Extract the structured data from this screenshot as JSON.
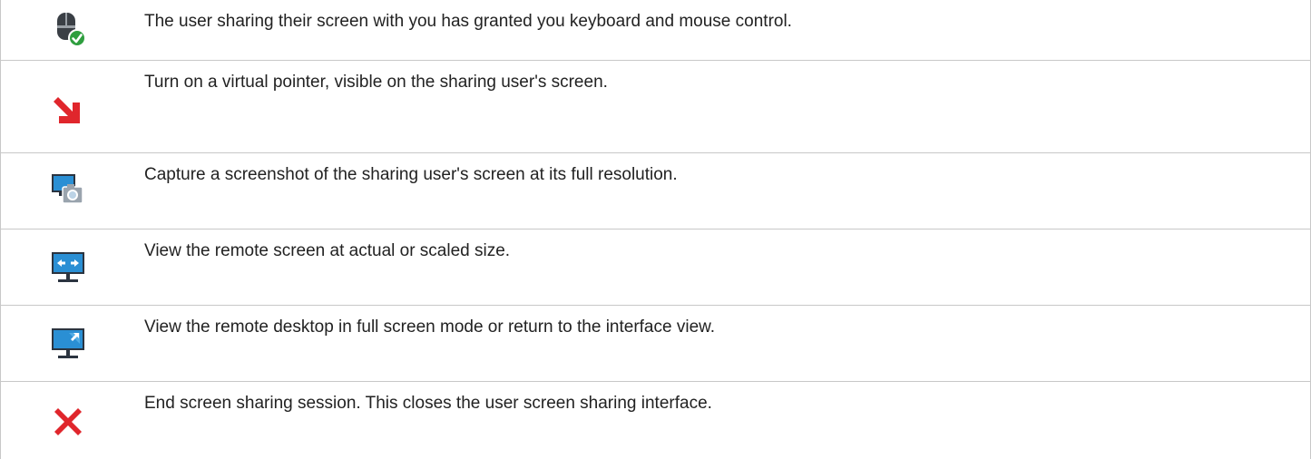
{
  "rows": [
    {
      "icon": "mouse-control-granted-icon",
      "text": "The user sharing their screen with you has granted you keyboard and mouse control."
    },
    {
      "icon": "virtual-pointer-icon",
      "text": "Turn on a virtual pointer, visible on the sharing user's screen."
    },
    {
      "icon": "screenshot-capture-icon",
      "text": "Capture a screenshot of the sharing user's screen at its full resolution."
    },
    {
      "icon": "scale-view-icon",
      "text": "View the remote screen at actual or scaled size."
    },
    {
      "icon": "full-screen-icon",
      "text": "View the remote desktop in full screen mode or return to the interface view."
    },
    {
      "icon": "end-session-icon",
      "text": "End screen sharing session. This closes the user screen sharing interface."
    }
  ],
  "colors": {
    "border": "#c8c8c8",
    "text": "#222222",
    "red": "#e0262c",
    "green": "#2e9e3e",
    "monitor_blue": "#2a8fd4",
    "monitor_dark": "#2b3440"
  }
}
